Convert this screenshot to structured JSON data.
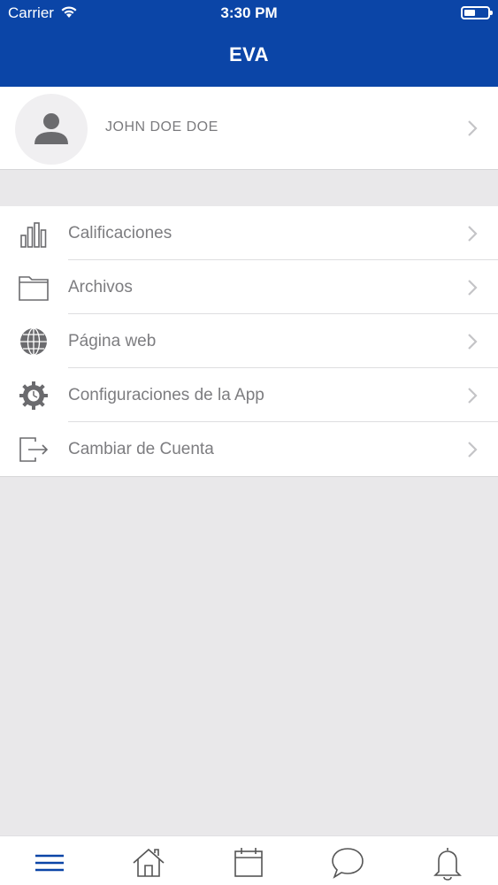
{
  "status_bar": {
    "carrier": "Carrier",
    "time": "3:30 PM"
  },
  "nav": {
    "title": "EVA"
  },
  "profile": {
    "name": "JOHN DOE DOE"
  },
  "menu": {
    "items": [
      {
        "label": "Calificaciones",
        "icon": "bar-chart-icon"
      },
      {
        "label": "Archivos",
        "icon": "folder-icon"
      },
      {
        "label": "Página web",
        "icon": "globe-icon"
      },
      {
        "label": "Configuraciones de la App",
        "icon": "gear-icon"
      },
      {
        "label": "Cambiar de Cuenta",
        "icon": "logout-icon"
      }
    ]
  },
  "tabbar": {
    "tabs": [
      {
        "icon": "menu-icon",
        "active": true
      },
      {
        "icon": "home-icon",
        "active": false
      },
      {
        "icon": "calendar-icon",
        "active": false
      },
      {
        "icon": "chat-icon",
        "active": false
      },
      {
        "icon": "bell-icon",
        "active": false
      }
    ]
  },
  "colors": {
    "header_bg": "#0b45a7",
    "text_gray": "#7d7d80",
    "active_tab": "#0b45a7",
    "inactive_tab": "#555555"
  }
}
